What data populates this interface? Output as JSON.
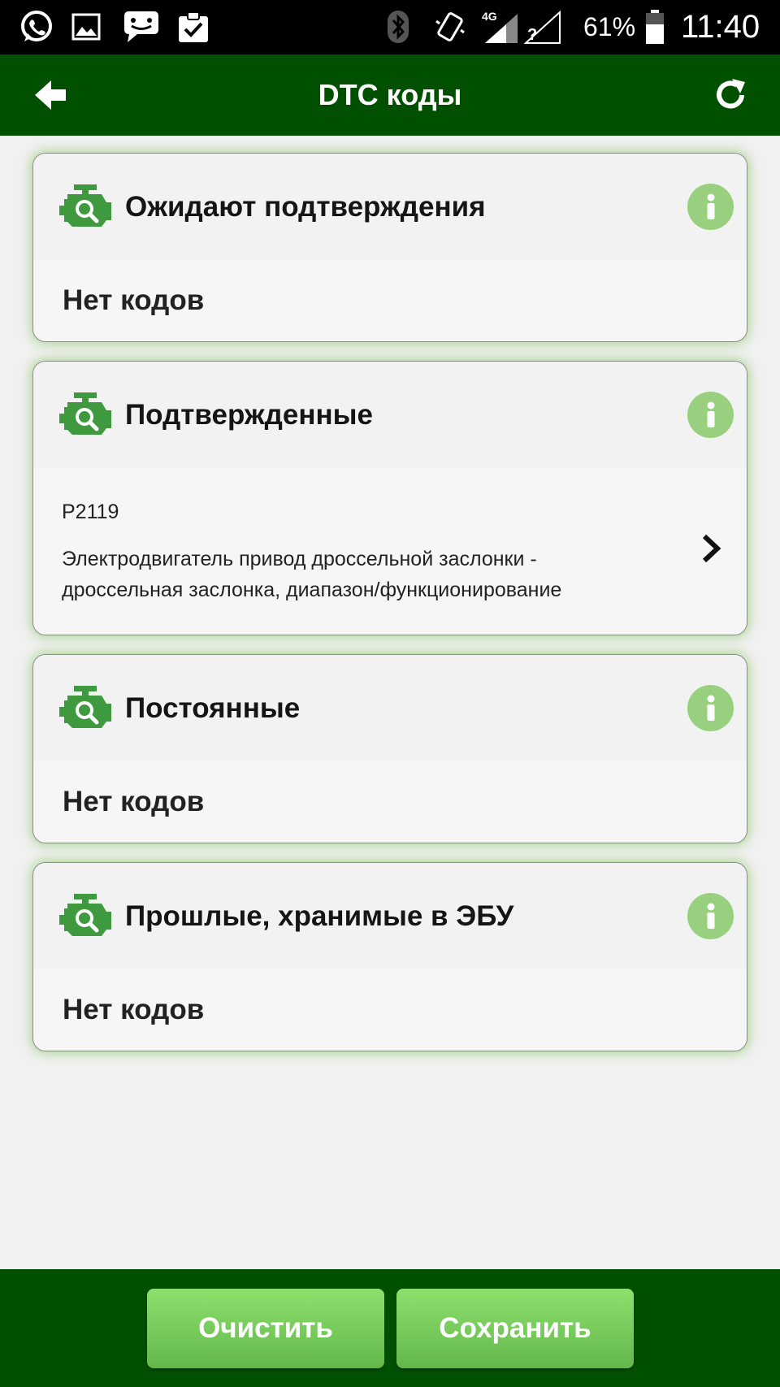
{
  "status_bar": {
    "battery_percent": "61%",
    "time": "11:40",
    "network": "4G",
    "icons": [
      "whatsapp-icon",
      "gallery-icon",
      "messenger-icon",
      "clipboard-check-icon",
      "bluetooth-icon",
      "vibrate-icon",
      "signal-icon",
      "no-signal-icon",
      "battery-icon"
    ]
  },
  "app_bar": {
    "title": "DTC коды",
    "back_icon": "arrow-left-icon",
    "refresh_icon": "refresh-icon"
  },
  "sections": [
    {
      "title": "Ожидают подтверждения",
      "empty_text": "Нет кодов"
    },
    {
      "title": "Подтвержденные",
      "codes": [
        {
          "code": "P2119",
          "description": "Электродвигатель привод дроссельной заслонки - дроссельная заслонка, диапазон/функционирование"
        }
      ]
    },
    {
      "title": "Постоянные",
      "empty_text": "Нет кодов"
    },
    {
      "title": "Прошлые, хранимые в ЭБУ",
      "empty_text": "Нет кодов"
    }
  ],
  "buttons": {
    "clear_label": "Очистить",
    "save_label": "Сохранить"
  },
  "colors": {
    "app_bar": "#005000",
    "accent_green": "#3f9a3f",
    "info_green": "#98d07f",
    "button_green": "#79cc5c"
  }
}
